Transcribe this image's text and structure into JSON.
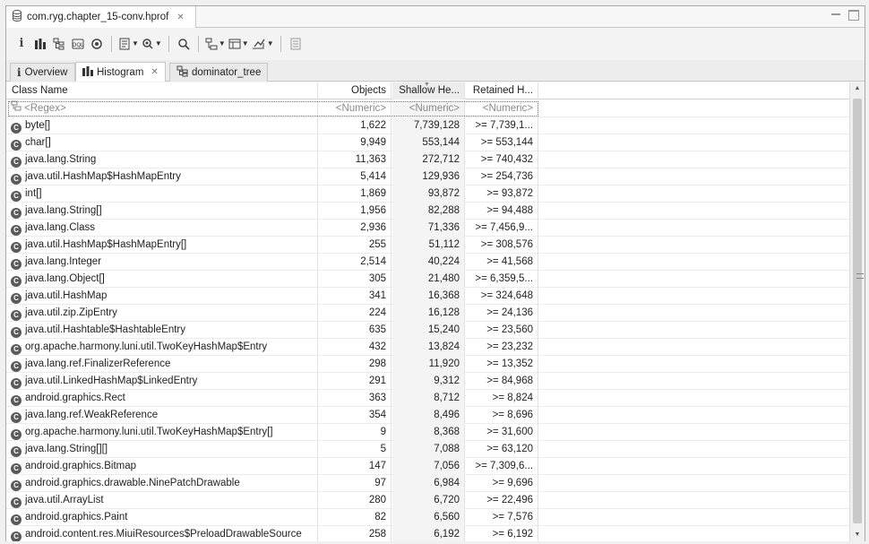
{
  "editor_tab": {
    "title": "com.ryg.chapter_15-conv.hprof",
    "close": "✕"
  },
  "toolbar": {
    "items": [
      "info-icon",
      "histogram-icon",
      "dominator-tree-icon",
      "oql-icon",
      "thread-overview-icon",
      "run-report-icon",
      "query-browser-icon",
      "search-icon",
      "group-by-icon",
      "calculate-retained-icon",
      "export-icon",
      "pin-icon"
    ]
  },
  "view_tabs": [
    {
      "label": "Overview",
      "icon": "info-icon"
    },
    {
      "label": "Histogram",
      "icon": "histogram-icon",
      "close": "✕"
    },
    {
      "label": "dominator_tree",
      "icon": "dominator-tree-icon"
    }
  ],
  "table": {
    "columns": [
      "Class Name",
      "Objects",
      "Shallow He...",
      "Retained H..."
    ],
    "filters": [
      "<Regex>",
      "<Numeric>",
      "<Numeric>",
      "<Numeric>"
    ],
    "rows": [
      [
        "byte[]",
        "1,622",
        "7,739,128",
        ">= 7,739,1..."
      ],
      [
        "char[]",
        "9,949",
        "553,144",
        ">= 553,144"
      ],
      [
        "java.lang.String",
        "11,363",
        "272,712",
        ">= 740,432"
      ],
      [
        "java.util.HashMap$HashMapEntry",
        "5,414",
        "129,936",
        ">= 254,736"
      ],
      [
        "int[]",
        "1,869",
        "93,872",
        ">= 93,872"
      ],
      [
        "java.lang.String[]",
        "1,956",
        "82,288",
        ">= 94,488"
      ],
      [
        "java.lang.Class",
        "2,936",
        "71,336",
        ">= 7,456,9..."
      ],
      [
        "java.util.HashMap$HashMapEntry[]",
        "255",
        "51,112",
        ">= 308,576"
      ],
      [
        "java.lang.Integer",
        "2,514",
        "40,224",
        ">= 41,568"
      ],
      [
        "java.lang.Object[]",
        "305",
        "21,480",
        ">= 6,359,5..."
      ],
      [
        "java.util.HashMap",
        "341",
        "16,368",
        ">= 324,648"
      ],
      [
        "java.util.zip.ZipEntry",
        "224",
        "16,128",
        ">= 24,136"
      ],
      [
        "java.util.Hashtable$HashtableEntry",
        "635",
        "15,240",
        ">= 23,560"
      ],
      [
        "org.apache.harmony.luni.util.TwoKeyHashMap$Entry",
        "432",
        "13,824",
        ">= 23,232"
      ],
      [
        "java.lang.ref.FinalizerReference",
        "298",
        "11,920",
        ">= 13,352"
      ],
      [
        "java.util.LinkedHashMap$LinkedEntry",
        "291",
        "9,312",
        ">= 84,968"
      ],
      [
        "android.graphics.Rect",
        "363",
        "8,712",
        ">= 8,824"
      ],
      [
        "java.lang.ref.WeakReference",
        "354",
        "8,496",
        ">= 8,696"
      ],
      [
        "org.apache.harmony.luni.util.TwoKeyHashMap$Entry[]",
        "9",
        "8,368",
        ">= 31,600"
      ],
      [
        "java.lang.String[][]",
        "5",
        "7,088",
        ">= 63,120"
      ],
      [
        "android.graphics.Bitmap",
        "147",
        "7,056",
        ">= 7,309,6..."
      ],
      [
        "android.graphics.drawable.NinePatchDrawable",
        "97",
        "6,984",
        ">= 9,696"
      ],
      [
        "java.util.ArrayList",
        "280",
        "6,720",
        ">= 22,496"
      ],
      [
        "android.graphics.Paint",
        "82",
        "6,560",
        ">= 7,576"
      ],
      [
        "android.content.res.MiuiResources$PreloadDrawableSource",
        "258",
        "6,192",
        ">= 6,192"
      ]
    ]
  }
}
